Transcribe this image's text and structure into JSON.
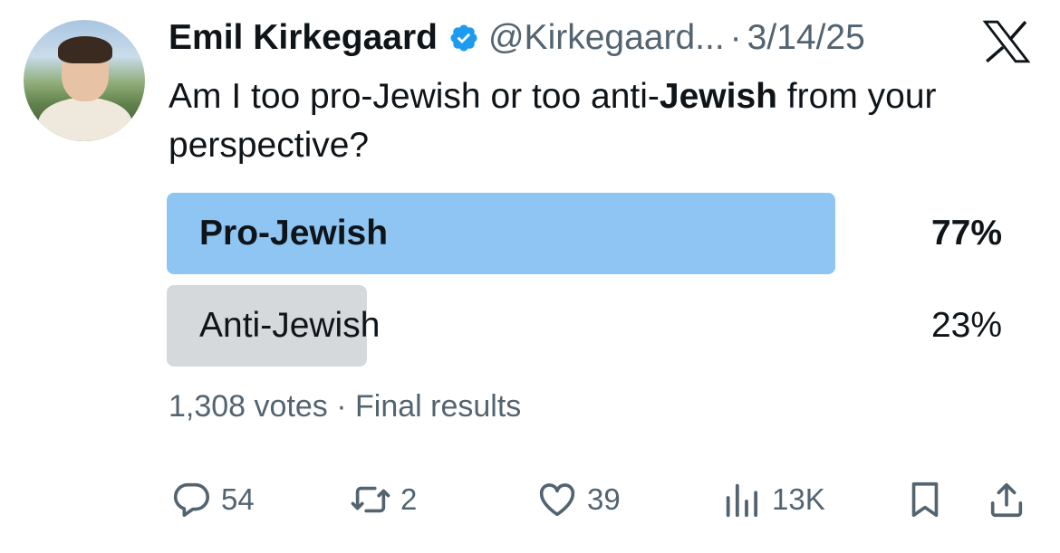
{
  "author": {
    "name": "Emil Kirkegaard",
    "handle": "@Kirkegaard...",
    "separator": "·",
    "date": "3/14/25"
  },
  "tweet": {
    "text_before": "Am I too pro-Jewish or too anti-",
    "text_bold": "Jewish",
    "text_after": " from your perspective?"
  },
  "poll": {
    "options": [
      {
        "label": "Pro-Jewish",
        "percent_text": "77%",
        "fraction": 0.77,
        "winner": true
      },
      {
        "label": "Anti-Jewish",
        "percent_text": "23%",
        "fraction": 0.23,
        "winner": false
      }
    ],
    "votes_text": "1,308 votes",
    "status_text": "Final results",
    "meta_separator": " · "
  },
  "actions": {
    "replies": "54",
    "reposts": "2",
    "likes": "39",
    "views": "13K"
  },
  "colors": {
    "winner_bar": "#8ec5f2",
    "other_bar": "#d5d9dc",
    "verified": "#1d9bf0",
    "secondary_text": "#536471"
  },
  "icons": {
    "verified": "verified-badge-icon",
    "logo": "x-logo-icon",
    "reply": "reply-icon",
    "repost": "repost-icon",
    "like": "heart-icon",
    "views": "views-chart-icon",
    "bookmark": "bookmark-icon",
    "share": "share-icon"
  }
}
